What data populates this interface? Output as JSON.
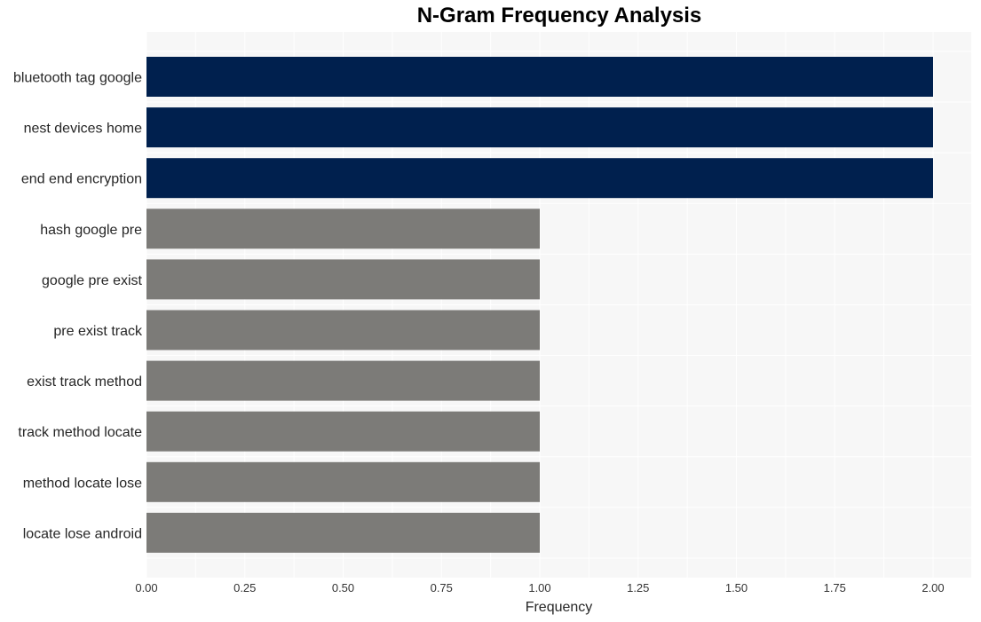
{
  "chart_data": {
    "type": "bar",
    "orientation": "horizontal",
    "title": "N-Gram Frequency Analysis",
    "xlabel": "Frequency",
    "ylabel": "",
    "categories": [
      "bluetooth tag google",
      "nest devices home",
      "end end encryption",
      "hash google pre",
      "google pre exist",
      "pre exist track",
      "exist track method",
      "track method locate",
      "method locate lose",
      "locate lose android"
    ],
    "values": [
      2,
      2,
      2,
      1,
      1,
      1,
      1,
      1,
      1,
      1
    ],
    "xlim": [
      0,
      2.1
    ],
    "xticks": [
      "0.00",
      "0.25",
      "0.50",
      "0.75",
      "1.00",
      "1.25",
      "1.50",
      "1.75",
      "2.00"
    ],
    "grid": true,
    "colors": {
      "top": "#00204e",
      "other": "#7c7b78",
      "plot_bg": "#f7f7f7",
      "grid": "#ffffff"
    },
    "legend": "none"
  }
}
